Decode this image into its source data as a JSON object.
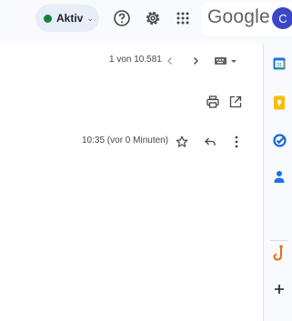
{
  "header": {
    "status": {
      "label": "Aktiv",
      "dot_color": "#188038"
    },
    "icons": [
      "help-icon",
      "settings-icon",
      "apps-grid-icon"
    ],
    "logo_text": "Google",
    "avatar_initial": "C"
  },
  "pager": {
    "text": "1 von 10.581",
    "prev_icon": "chevron-left-icon",
    "next_icon": "chevron-right-icon",
    "input_tools_icon": "keyboard-icon"
  },
  "message_actions": {
    "print_icon": "print-icon",
    "open_new_window_icon": "open-in-new-icon",
    "timestamp": "10:35 (vor 0 Minuten)",
    "star_icon": "star-icon",
    "reply_icon": "reply-icon",
    "more_icon": "more-vert-icon"
  },
  "side_rail": {
    "items": [
      "calendar-icon",
      "keep-icon",
      "tasks-icon",
      "contacts-icon",
      "addon-icon",
      "add-icon"
    ],
    "colors": {
      "calendar": "#1a73e8",
      "keep": "#fbbc04",
      "tasks": "#1967d2",
      "contacts": "#1a73e8",
      "addon": "#e8710a"
    }
  }
}
